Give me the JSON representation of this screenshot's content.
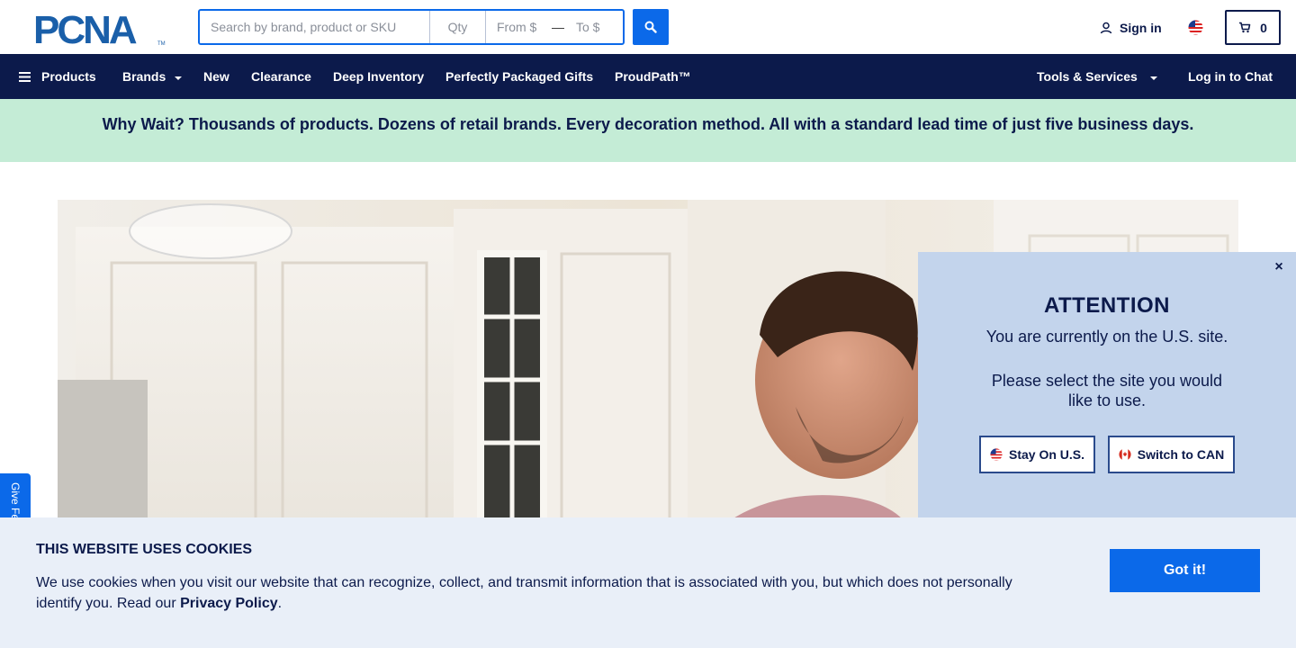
{
  "header": {
    "logo_text": "PCNA",
    "search": {
      "placeholder": "Search by brand, product or SKU",
      "qty_placeholder": "Qty",
      "from_placeholder": "From $",
      "dash": "—",
      "to_placeholder": "To $"
    },
    "signin_label": "Sign in",
    "cart_count": "0"
  },
  "nav": {
    "products": "Products",
    "brands": "Brands",
    "new": "New",
    "clearance": "Clearance",
    "deep_inventory": "Deep Inventory",
    "gifts": "Perfectly Packaged Gifts",
    "proudpath": "ProudPath™",
    "tools": "Tools & Services",
    "chat": "Log in to Chat"
  },
  "promo": {
    "text": "Why Wait? Thousands of products. Dozens of retail brands. Every decoration method. All with a standard lead time of just five business days."
  },
  "feedback": {
    "label": "Give Feedback"
  },
  "modal": {
    "close": "×",
    "title": "ATTENTION",
    "line1": "You are currently on the U.S. site.",
    "line2": "Please select the site you would like to use.",
    "stay_label": "Stay On U.S.",
    "switch_label": "Switch to CAN"
  },
  "cookies": {
    "title": "THIS WEBSITE USES COOKIES",
    "text": "We use cookies when you visit our website that can recognize, collect, and transmit information that is associated with you, but which does not personally identify you. Read our ",
    "link": "Privacy Policy",
    "period": ".",
    "button": "Got it!"
  },
  "colors": {
    "navy": "#0c1a4b",
    "accent_blue": "#0b69e9",
    "promo_green": "#c4ecd6",
    "modal_bg": "#c3d4ec",
    "cookie_bg": "#e9eff8"
  }
}
